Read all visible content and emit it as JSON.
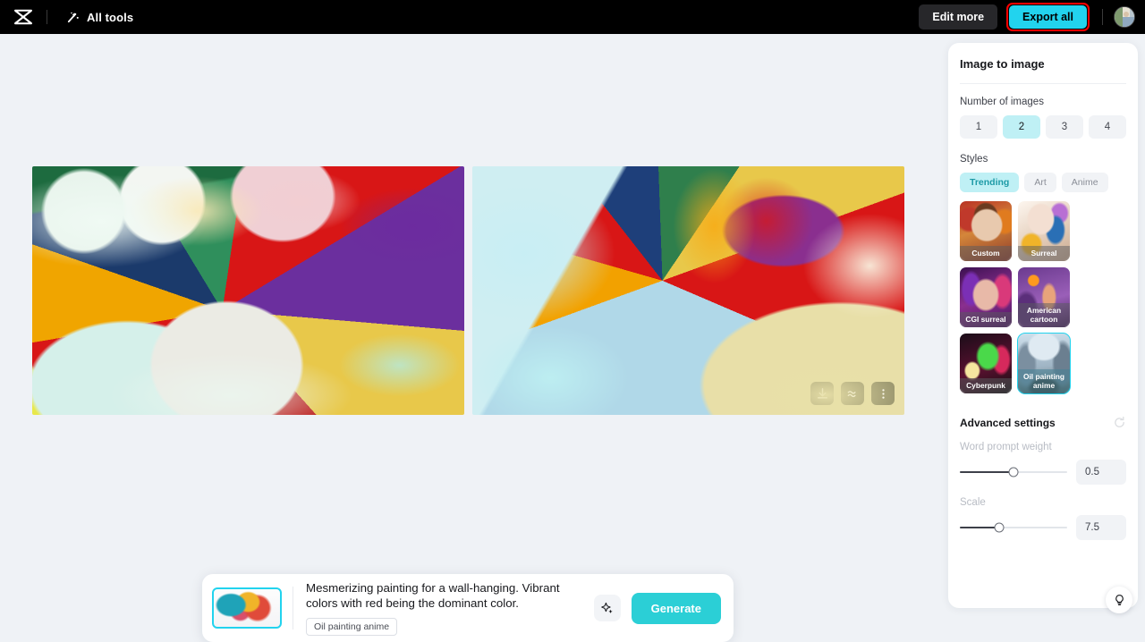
{
  "topbar": {
    "logo_icon": "capcut-logo-icon",
    "all_tools_label": "All tools",
    "all_tools_icon": "magic-wand-icon",
    "edit_more_label": "Edit more",
    "export_all_label": "Export all",
    "avatar_icon": "user-avatar",
    "export_highlight_color": "#ff0000",
    "export_bg_color": "#22d3ee"
  },
  "canvas": {
    "images": [
      {
        "alt": "generated-image-1"
      },
      {
        "alt": "generated-image-2"
      }
    ],
    "image_toolbar": {
      "download_icon": "download-icon",
      "enhance_icon": "enhance-wave-icon",
      "more_icon": "more-vertical-icon"
    }
  },
  "prompt_bar": {
    "thumbnail_icon": "source-image-thumbnail",
    "prompt_text": "Mesmerizing painting for a wall-hanging. Vibrant colors with red being the dominant color.",
    "style_tag": "Oil painting anime",
    "magic_icon": "sparkle-icon",
    "generate_label": "Generate",
    "generate_bg_color": "#2bcfd6"
  },
  "panel": {
    "title": "Image to image",
    "number_of_images": {
      "label": "Number of images",
      "options": [
        "1",
        "2",
        "3",
        "4"
      ],
      "selected": "2"
    },
    "styles": {
      "label": "Styles",
      "tabs": [
        "Trending",
        "Art",
        "Anime"
      ],
      "selected_tab": "Trending",
      "cards": [
        {
          "label": "Custom",
          "selected": false
        },
        {
          "label": "Surreal",
          "selected": false
        },
        {
          "label": "CGI surreal",
          "selected": false
        },
        {
          "label": "American cartoon",
          "selected": false
        },
        {
          "label": "Cyberpunk",
          "selected": false
        },
        {
          "label": "Oil painting anime",
          "selected": true
        }
      ]
    },
    "advanced": {
      "title": "Advanced settings",
      "reset_icon": "reset-icon",
      "sliders": [
        {
          "label": "Word prompt weight",
          "value": "0.5",
          "percent": 50
        },
        {
          "label": "Scale",
          "value": "7.5",
          "percent": 37
        }
      ]
    }
  },
  "help": {
    "icon": "lightbulb-icon"
  }
}
